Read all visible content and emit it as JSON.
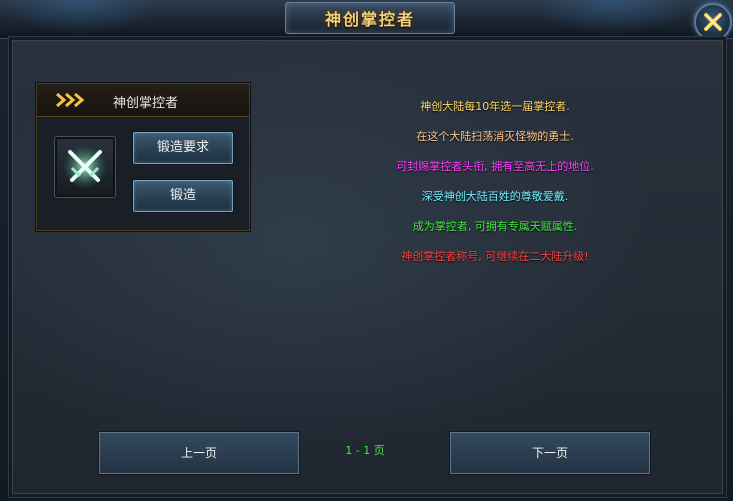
{
  "window": {
    "title": "神创掌控者",
    "close_icon": "close-x-icon"
  },
  "card": {
    "title": "神创掌控者",
    "badge_icon": "crossed-swords-icon",
    "buttons": {
      "requirements": "锻造要求",
      "forge": "锻造"
    }
  },
  "description": [
    {
      "text": "神创大陆每10年选一届掌控者.",
      "color": "#ffd86a"
    },
    {
      "text": "在这个大陆扫荡消灭怪物的勇士.",
      "color": "#ffc890"
    },
    {
      "text": "可封赐掌控者头衔, 拥有至高无上的地位.",
      "color": "#ff40ff"
    },
    {
      "text": "深受神创大陆百姓的尊敬爱戴.",
      "color": "#6ff0ff"
    },
    {
      "text": "成为掌控者, 可拥有专属天赋属性.",
      "color": "#44e844"
    },
    {
      "text": "神创掌控者称号, 可继续在二大陆升级!",
      "color": "#ff4040"
    }
  ],
  "pagination": {
    "prev": "上一页",
    "next": "下一页",
    "indicator": "1 - 1 页"
  }
}
